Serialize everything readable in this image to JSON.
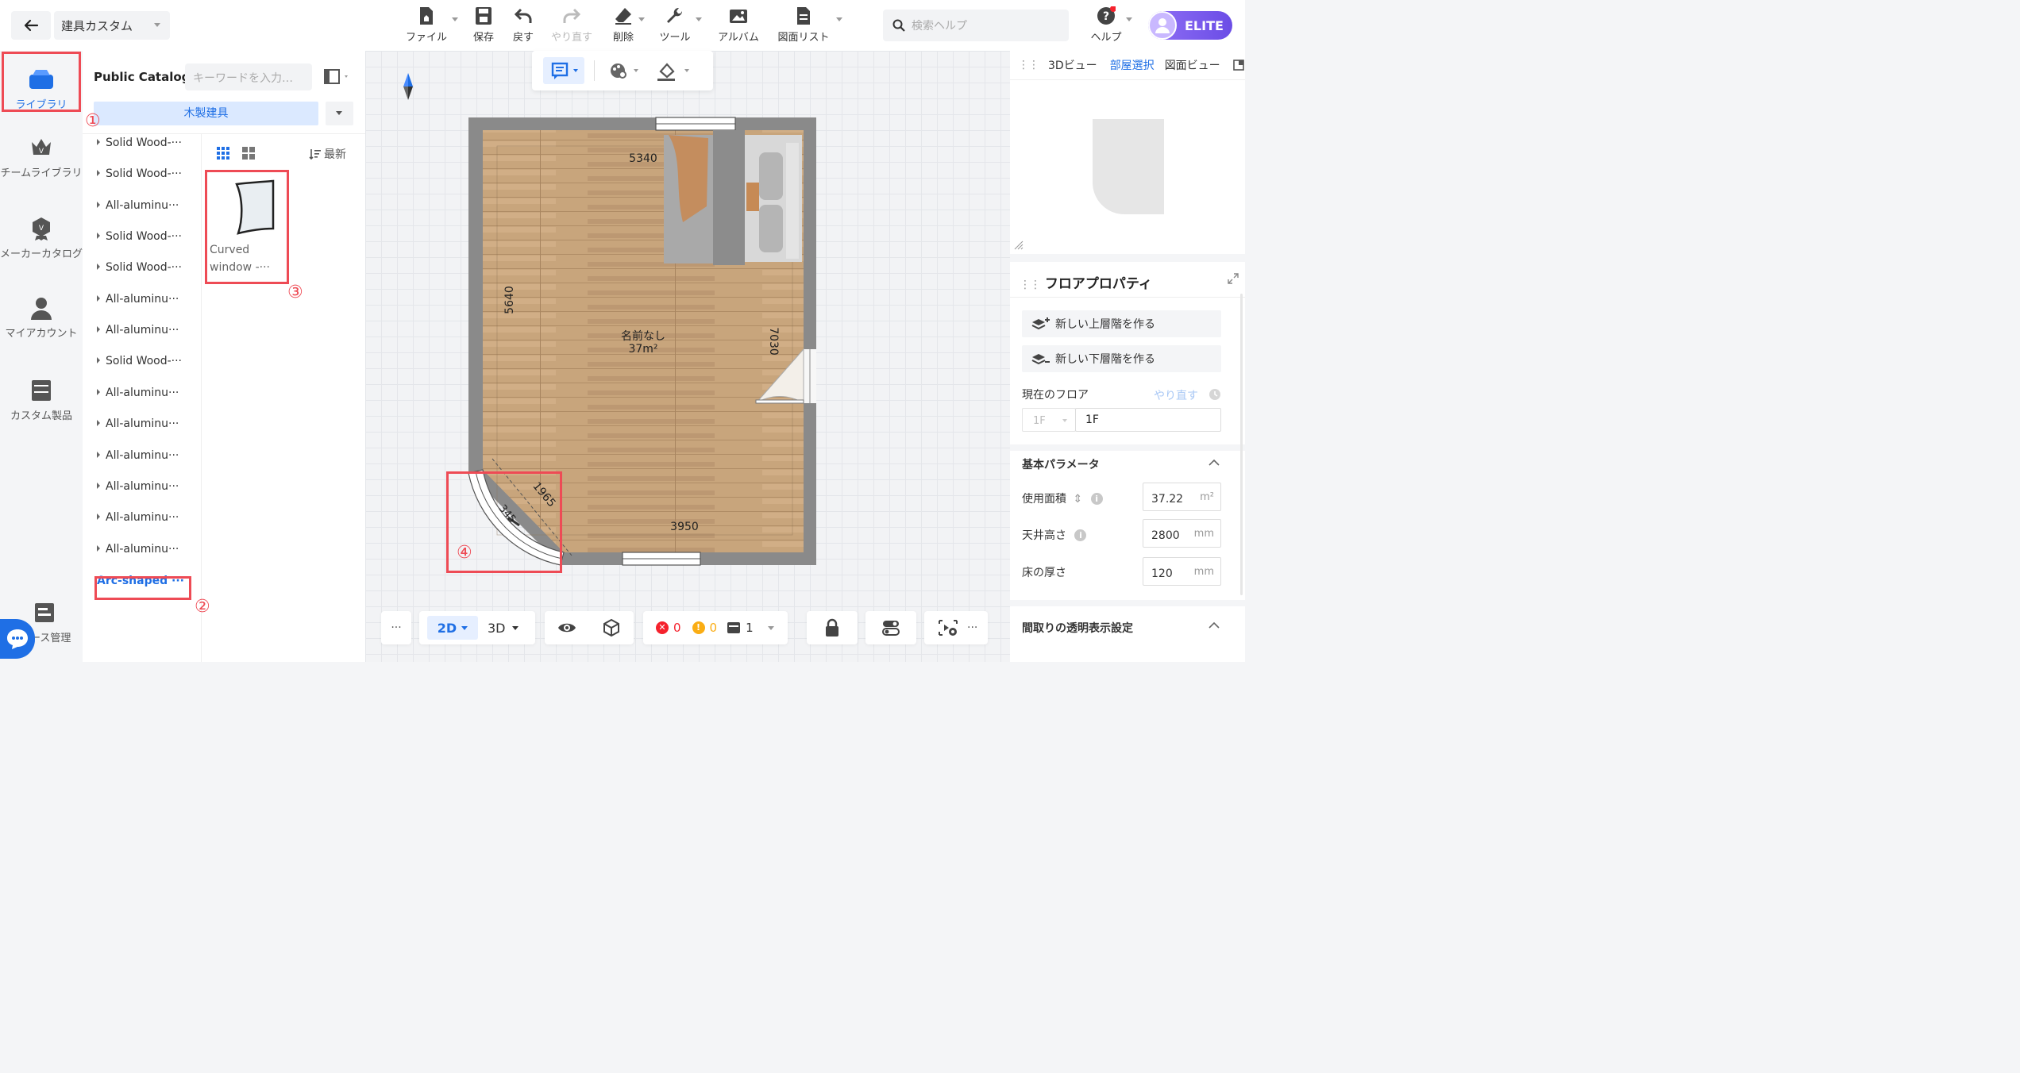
{
  "header": {
    "project_name": "建具カスタム",
    "tools": [
      {
        "label": "ファイル",
        "icon": "file-icon"
      },
      {
        "label": "保存",
        "icon": "save-icon"
      },
      {
        "label": "戻す",
        "icon": "undo-icon"
      },
      {
        "label": "やり直す",
        "icon": "redo-icon"
      },
      {
        "label": "削除",
        "icon": "eraser-icon"
      },
      {
        "label": "ツール",
        "icon": "wrench-icon"
      },
      {
        "label": "アルバム",
        "icon": "album-icon"
      },
      {
        "label": "図面リスト",
        "icon": "drawing-list-icon"
      }
    ],
    "search_placeholder": "検索ヘルプ",
    "help_label": "ヘルプ",
    "badge": "ELITE"
  },
  "rail": {
    "items": [
      {
        "label": "ライブラリ",
        "icon": "library-icon",
        "active": true
      },
      {
        "label": "チームライブラリ",
        "icon": "team-library-icon"
      },
      {
        "label": "メーカーカタログ",
        "icon": "maker-catalog-icon"
      },
      {
        "label": "マイアカウント",
        "icon": "account-icon"
      },
      {
        "label": "カスタム製品",
        "icon": "custom-products-icon"
      }
    ],
    "bottom_label": "ース管理"
  },
  "library": {
    "title": "Public Catalog",
    "search_placeholder": "キーワードを入力…",
    "category": "木製建具",
    "sort_label": "最新",
    "categories": [
      "Solid Wood-···",
      "Solid Wood-···",
      "All-aluminu···",
      "Solid Wood-···",
      "Solid Wood-···",
      "All-aluminu···",
      "All-aluminu···",
      "Solid Wood-···",
      "All-aluminu···",
      "All-aluminu···",
      "All-aluminu···",
      "All-aluminu···",
      "All-aluminu···",
      "All-aluminu···",
      "Arc-shaped ···"
    ],
    "products": [
      {
        "name_line1": "Curved",
        "name_line2": "window -···"
      }
    ]
  },
  "annotations": [
    "①",
    "②",
    "③",
    "④"
  ],
  "floorplan": {
    "room_name": "名前なし",
    "room_area": "37m²",
    "dimensions": {
      "top": "5340",
      "left": "5640",
      "right": "7030",
      "bottom": "3950",
      "diagonal": "1965",
      "arc": "345"
    }
  },
  "bottom_toolbar": {
    "view_2d": "2D",
    "view_3d": "3D",
    "errors": "0",
    "warnings": "0",
    "layers": "1",
    "more": "···"
  },
  "right_panel": {
    "tabs": [
      "3Dビュー",
      "部屋選択",
      "図面ビュー"
    ],
    "active_tab": "部屋選択",
    "props_title": "フロアプロパティ",
    "new_upper": "新しい上層階を作る",
    "new_lower": "新しい下層階を作る",
    "current_floor_label": "現在のフロア",
    "redo_label": "やり直す",
    "floor_select": "1F",
    "floor_name": "1F",
    "basic_params": "基本パラメータ",
    "area_label": "使用面積",
    "area_value": "37.22",
    "area_unit": "m²",
    "ceiling_label": "天井高さ",
    "ceiling_value": "2800",
    "thickness_label": "床の厚さ",
    "thickness_value": "120",
    "mm": "mm",
    "transparency": "間取りの透明表示設定"
  },
  "colors": {
    "accent": "#1f6fe5",
    "annotation_red": "#ee4b55",
    "elite_purple": "#7b5cf0"
  }
}
